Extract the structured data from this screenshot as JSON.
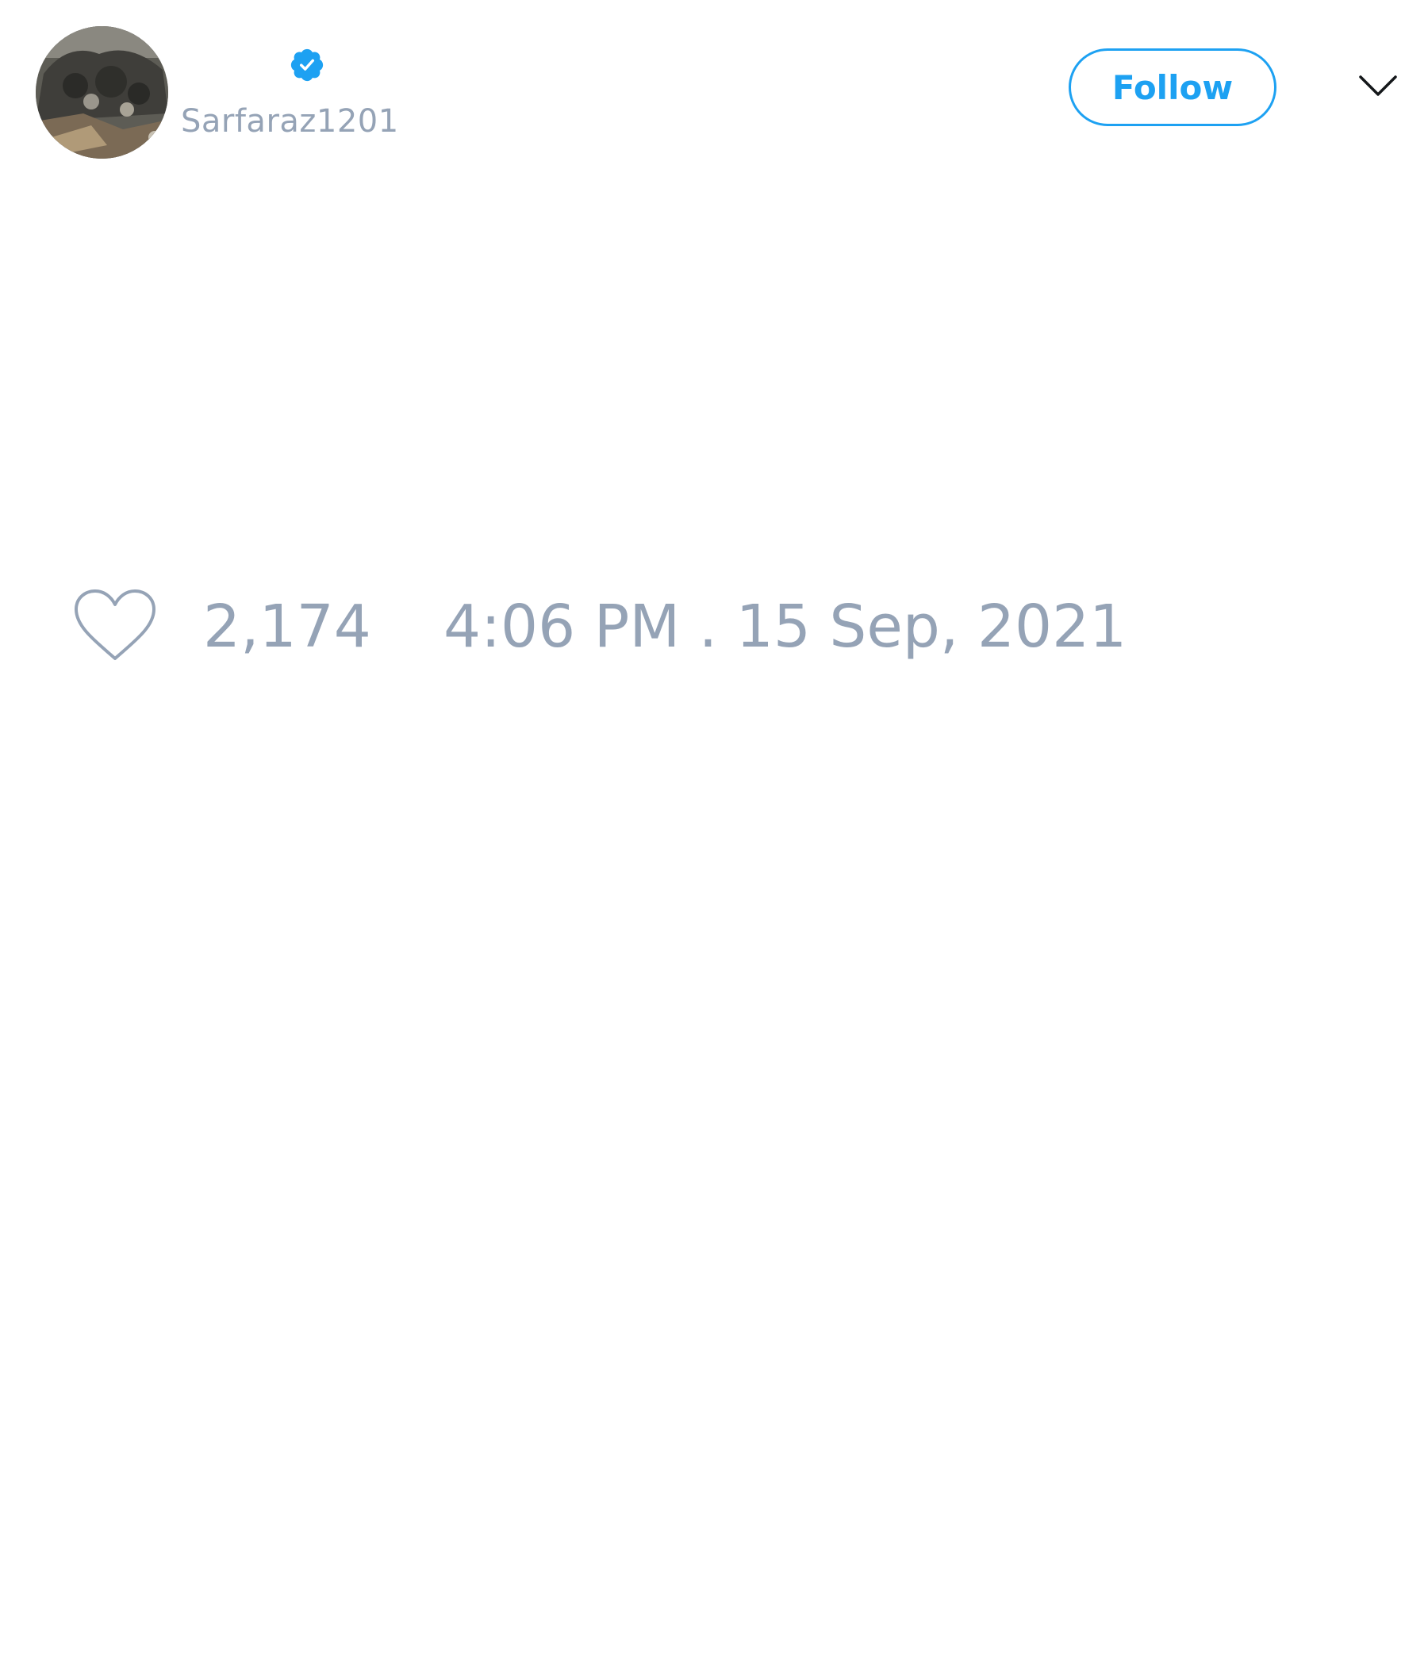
{
  "author": {
    "handle": "Sarfaraz1201",
    "verified": true,
    "avatar_icon": "profile-photo",
    "verified_icon": "verified-badge-icon"
  },
  "actions": {
    "follow_label": "Follow",
    "menu_icon": "chevron-down-icon"
  },
  "stats": {
    "like_icon": "heart-icon",
    "likes": "2,174",
    "timestamp": "4:06 PM . 15 Sep, 2021"
  },
  "colors": {
    "accent": "#1da1f2",
    "muted_text": "#95a3b6",
    "background": "#ffffff"
  }
}
